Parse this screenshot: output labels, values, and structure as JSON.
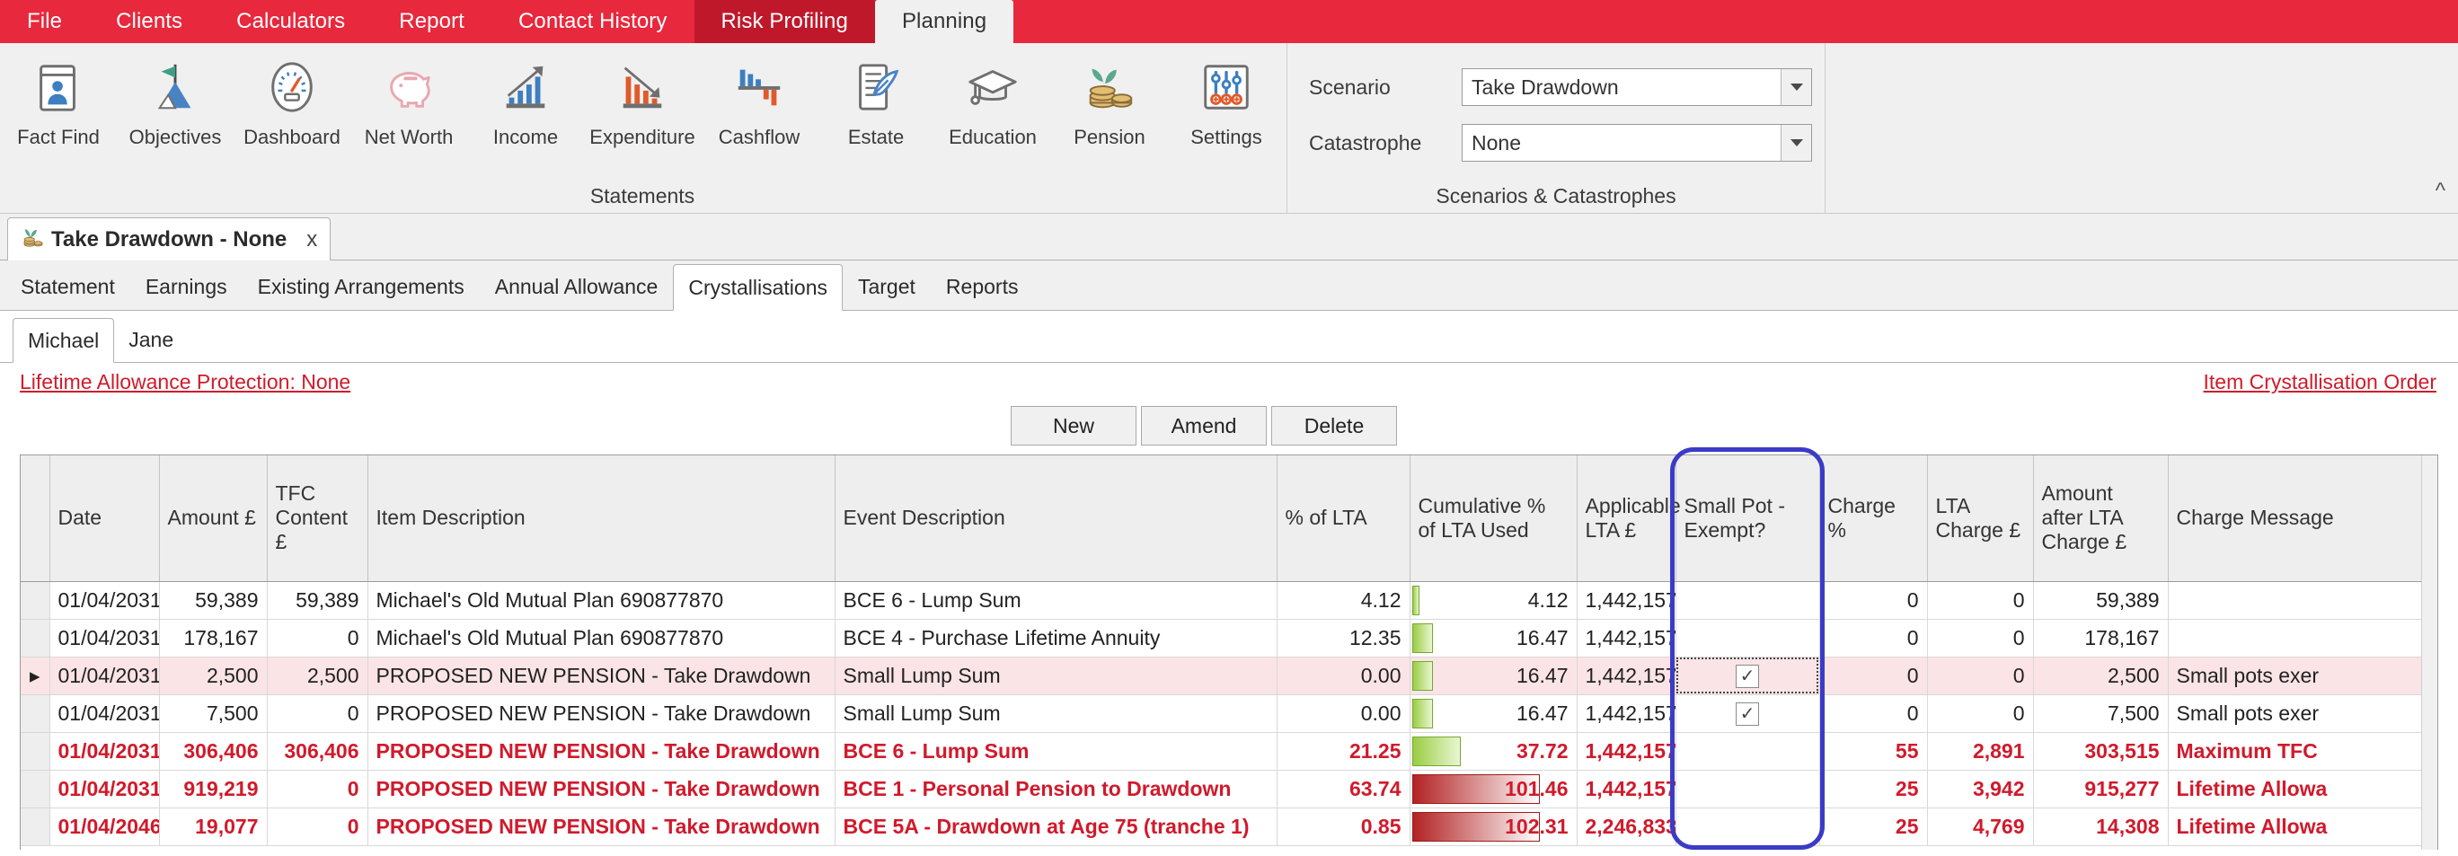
{
  "menu": {
    "items": [
      {
        "label": "File",
        "state": "normal"
      },
      {
        "label": "Clients",
        "state": "normal"
      },
      {
        "label": "Calculators",
        "state": "normal"
      },
      {
        "label": "Report",
        "state": "normal"
      },
      {
        "label": "Contact History",
        "state": "normal"
      },
      {
        "label": "Risk Profiling",
        "state": "dark"
      },
      {
        "label": "Planning",
        "state": "active"
      }
    ]
  },
  "ribbon": {
    "group_caption_statements": "Statements",
    "group_caption_scenarios": "Scenarios & Catastrophes",
    "buttons": [
      {
        "label": "Fact Find",
        "icon": "fact-find-icon"
      },
      {
        "label": "Objectives",
        "icon": "objectives-flag-icon"
      },
      {
        "label": "Dashboard",
        "icon": "dashboard-gauge-icon"
      },
      {
        "label": "Net Worth",
        "icon": "piggy-bank-icon"
      },
      {
        "label": "Income",
        "icon": "income-bar-up-icon"
      },
      {
        "label": "Expenditure",
        "icon": "expenditure-bar-down-icon"
      },
      {
        "label": "Cashflow",
        "icon": "cashflow-bars-icon"
      },
      {
        "label": "Estate",
        "icon": "estate-quill-icon"
      },
      {
        "label": "Education",
        "icon": "education-cap-icon"
      },
      {
        "label": "Pension",
        "icon": "pension-coins-icon"
      },
      {
        "label": "Settings",
        "icon": "settings-sliders-icon"
      }
    ],
    "scenario_label": "Scenario",
    "scenario_value": "Take Drawdown",
    "catastrophe_label": "Catastrophe",
    "catastrophe_value": "None",
    "collapse_icon": "collapse-ribbon-chevron-icon"
  },
  "document_tab": {
    "title": "Take Drawdown - None",
    "close_label": "x",
    "icon": "plant-coins-icon"
  },
  "tabs": [
    {
      "label": "Statement",
      "selected": false
    },
    {
      "label": "Earnings",
      "selected": false
    },
    {
      "label": "Existing Arrangements",
      "selected": false
    },
    {
      "label": "Annual Allowance",
      "selected": false
    },
    {
      "label": "Crystallisations",
      "selected": true
    },
    {
      "label": "Target",
      "selected": false
    },
    {
      "label": "Reports",
      "selected": false
    }
  ],
  "subtabs": [
    {
      "label": "Michael",
      "selected": true
    },
    {
      "label": "Jane",
      "selected": false
    }
  ],
  "links": {
    "lta_protection": "Lifetime Allowance Protection: None",
    "crystallisation_order": "Item Crystallisation Order"
  },
  "buttons": [
    {
      "label": "New"
    },
    {
      "label": "Amend"
    },
    {
      "label": "Delete"
    }
  ],
  "grid": {
    "columns": [
      "Date",
      "Amount £",
      "TFC Content £",
      "Item Description",
      "Event Description",
      "% of LTA",
      "Cumulative % of LTA Used",
      "Applicable LTA £",
      "Small Pot - Exempt?",
      "Charge %",
      "LTA Charge £",
      "Amount after LTA Charge £",
      "Charge Message"
    ],
    "rows": [
      {
        "marker": "",
        "date": "01/04/2031",
        "amount": "59,389",
        "tfc": "59,389",
        "item": "Michael's Old Mutual Plan 690877870",
        "event": "BCE 6 - Lump Sum",
        "pct_lta": "4.12",
        "cum_pct": "4.12",
        "cum_val": 4.12,
        "applicable_lta": "1,442,157",
        "small_pot": false,
        "charge_pct": "0",
        "lta_charge": "0",
        "amount_after": "59,389",
        "charge_message": "",
        "style": "normal"
      },
      {
        "marker": "",
        "date": "01/04/2031",
        "amount": "178,167",
        "tfc": "0",
        "item": "Michael's Old Mutual Plan 690877870",
        "event": "BCE 4 - Purchase Lifetime Annuity",
        "pct_lta": "12.35",
        "cum_pct": "16.47",
        "cum_val": 16.47,
        "applicable_lta": "1,442,157",
        "small_pot": false,
        "charge_pct": "0",
        "lta_charge": "0",
        "amount_after": "178,167",
        "charge_message": "",
        "style": "normal"
      },
      {
        "marker": "▸",
        "date": "01/04/2031",
        "amount": "2,500",
        "tfc": "2,500",
        "item": "PROPOSED NEW PENSION - Take Drawdown",
        "event": "Small Lump Sum",
        "pct_lta": "0.00",
        "cum_pct": "16.47",
        "cum_val": 16.47,
        "applicable_lta": "1,442,157",
        "small_pot": true,
        "charge_pct": "0",
        "lta_charge": "0",
        "amount_after": "2,500",
        "charge_message": "Small pots exer",
        "style": "selected"
      },
      {
        "marker": "",
        "date": "01/04/2031",
        "amount": "7,500",
        "tfc": "0",
        "item": "PROPOSED NEW PENSION - Take Drawdown",
        "event": "Small Lump Sum",
        "pct_lta": "0.00",
        "cum_pct": "16.47",
        "cum_val": 16.47,
        "applicable_lta": "1,442,157",
        "small_pot": true,
        "charge_pct": "0",
        "lta_charge": "0",
        "amount_after": "7,500",
        "charge_message": "Small pots exer",
        "style": "normal"
      },
      {
        "marker": "",
        "date": "01/04/2031",
        "amount": "306,406",
        "tfc": "306,406",
        "item": "PROPOSED NEW PENSION - Take Drawdown",
        "event": "BCE 6 - Lump Sum",
        "pct_lta": "21.25",
        "cum_pct": "37.72",
        "cum_val": 37.72,
        "applicable_lta": "1,442,157",
        "small_pot": false,
        "charge_pct": "55",
        "lta_charge": "2,891",
        "amount_after": "303,515",
        "charge_message": "Maximum TFC",
        "style": "red"
      },
      {
        "marker": "",
        "date": "01/04/2031",
        "amount": "919,219",
        "tfc": "0",
        "item": "PROPOSED NEW PENSION - Take Drawdown",
        "event": "BCE 1 - Personal Pension to Drawdown",
        "pct_lta": "63.74",
        "cum_pct": "101.46",
        "cum_val": 101.46,
        "applicable_lta": "1,442,157",
        "small_pot": false,
        "charge_pct": "25",
        "lta_charge": "3,942",
        "amount_after": "915,277",
        "charge_message": "Lifetime Allowa",
        "style": "red"
      },
      {
        "marker": "",
        "date": "01/04/2046",
        "amount": "19,077",
        "tfc": "0",
        "item": "PROPOSED NEW PENSION - Take Drawdown",
        "event": "BCE 5A - Drawdown at Age 75 (tranche 1)",
        "pct_lta": "0.85",
        "cum_pct": "102.31",
        "cum_val": 102.31,
        "applicable_lta": "2,246,833",
        "small_pot": false,
        "charge_pct": "25",
        "lta_charge": "4,769",
        "amount_after": "14,308",
        "charge_message": "Lifetime Allowa",
        "style": "red"
      }
    ]
  },
  "colors": {
    "brand_red": "#e8283c",
    "brand_red_dark": "#c0182b",
    "link_red": "#d01a2b",
    "highlight_blue": "#3b3bc8",
    "row_selected_pink": "#fbe4e6",
    "bar_green": "#9acd44",
    "bar_red": "#b22222"
  }
}
